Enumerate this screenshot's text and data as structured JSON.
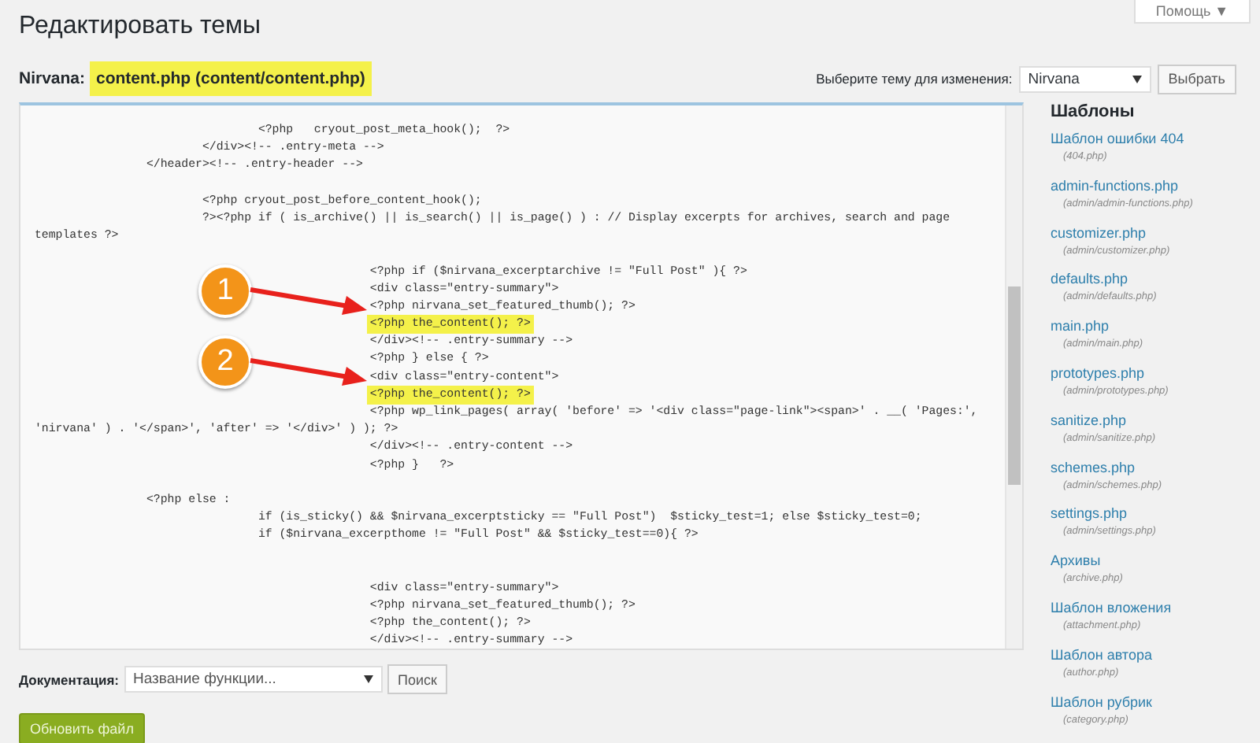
{
  "page_title": "Редактировать темы",
  "help_button": "Помощь ▼",
  "file_heading": {
    "theme": "Nirvana:",
    "file": "content.php (content/content.php)",
    "highlighted": true
  },
  "theme_picker": {
    "label": "Выберите тему для изменения:",
    "value": "Nirvana",
    "button": "Выбрать"
  },
  "code_lines": [
    {
      "kind": "code",
      "text": "                                <?php   cryout_post_meta_hook();  ?>",
      "highlighted": false
    },
    {
      "kind": "code",
      "text": "                        </div><!-- .entry-meta -->",
      "highlighted": false
    },
    {
      "kind": "code",
      "text": "                </header><!-- .entry-header -->",
      "highlighted": false
    },
    {
      "kind": "blank"
    },
    {
      "kind": "code",
      "text": "                        <?php cryout_post_before_content_hook();",
      "highlighted": false
    },
    {
      "kind": "code",
      "text": "                        ?><?php if ( is_archive() || is_search() || is_page() ) : // Display excerpts for archives, search and page",
      "highlighted": false
    },
    {
      "kind": "code",
      "text": "templates ?>",
      "highlighted": false
    },
    {
      "kind": "blank"
    },
    {
      "kind": "code",
      "text": "                                                <?php if ($nirvana_excerptarchive != \"Full Post\" ){ ?>",
      "highlighted": false
    },
    {
      "kind": "code",
      "text": "                                                <div class=\"entry-summary\">",
      "highlighted": false
    },
    {
      "kind": "code",
      "text": "                                                <?php nirvana_set_featured_thumb(); ?>",
      "highlighted": false
    },
    {
      "kind": "code",
      "text": "                                                <?php the_content(); ?>",
      "highlighted": true,
      "marker": "1"
    },
    {
      "kind": "code",
      "text": "                                                </div><!-- .entry-summary -->",
      "highlighted": false
    },
    {
      "kind": "code",
      "text": "                                                <?php } else { ?>",
      "highlighted": false
    },
    {
      "kind": "code",
      "text": "                                                <div class=\"entry-content\">",
      "highlighted": false
    },
    {
      "kind": "code",
      "text": "                                                <?php the_content(); ?>",
      "highlighted": true,
      "marker": "2"
    },
    {
      "kind": "code",
      "text": "                                                <?php wp_link_pages( array( 'before' => '<div class=\"page-link\"><span>' . __( 'Pages:',",
      "highlighted": false
    },
    {
      "kind": "code",
      "text": "'nirvana' ) . '</span>', 'after' => '</div>' ) ); ?>",
      "highlighted": false
    },
    {
      "kind": "code",
      "text": "                                                </div><!-- .entry-content -->",
      "highlighted": false
    },
    {
      "kind": "code",
      "text": "                                                <?php }   ?>",
      "highlighted": false
    },
    {
      "kind": "blank"
    },
    {
      "kind": "code",
      "text": "                <?php else :",
      "highlighted": false
    },
    {
      "kind": "code",
      "text": "                                if (is_sticky() && $nirvana_excerptsticky == \"Full Post\")  $sticky_test=1; else $sticky_test=0;",
      "highlighted": false
    },
    {
      "kind": "code",
      "text": "                                if ($nirvana_excerpthome != \"Full Post\" && $sticky_test==0){ ?>",
      "highlighted": false
    },
    {
      "kind": "blank"
    },
    {
      "kind": "blank"
    },
    {
      "kind": "code",
      "text": "                                                <div class=\"entry-summary\">",
      "highlighted": false
    },
    {
      "kind": "code",
      "text": "                                                <?php nirvana_set_featured_thumb(); ?>",
      "highlighted": false
    },
    {
      "kind": "code",
      "text": "                                                <?php the_content(); ?>",
      "highlighted": false
    },
    {
      "kind": "code",
      "text": "                                                </div><!-- .entry-summary -->",
      "highlighted": false
    }
  ],
  "templates": {
    "title": "Шаблоны",
    "items": [
      {
        "name": "Шаблон ошибки 404",
        "path": "(404.php)"
      },
      {
        "name": "admin-functions.php",
        "path": "(admin/admin-functions.php)"
      },
      {
        "name": "customizer.php",
        "path": "(admin/customizer.php)"
      },
      {
        "name": "defaults.php",
        "path": "(admin/defaults.php)"
      },
      {
        "name": "main.php",
        "path": "(admin/main.php)"
      },
      {
        "name": "prototypes.php",
        "path": "(admin/prototypes.php)"
      },
      {
        "name": "sanitize.php",
        "path": "(admin/sanitize.php)"
      },
      {
        "name": "schemes.php",
        "path": "(admin/schemes.php)"
      },
      {
        "name": "settings.php",
        "path": "(admin/settings.php)"
      },
      {
        "name": "Архивы",
        "path": "(archive.php)"
      },
      {
        "name": "Шаблон вложения",
        "path": "(attachment.php)"
      },
      {
        "name": "Шаблон автора",
        "path": "(author.php)"
      },
      {
        "name": "Шаблон рубрик",
        "path": "(category.php)"
      }
    ]
  },
  "documentation": {
    "label": "Документация:",
    "placeholder": "Название функции...",
    "button": "Поиск"
  },
  "update_button": "Обновить файл"
}
